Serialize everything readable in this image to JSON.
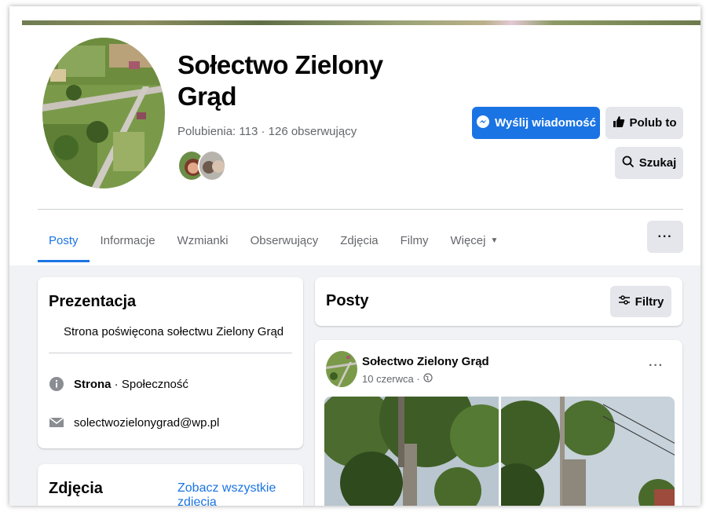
{
  "page": {
    "title": "Sołectwo Zielony Grąd",
    "stats": "Polubienia: 113 · 126 obserwujący"
  },
  "actions": {
    "message_label": "Wyślij wiadomość",
    "like_label": "Polub to",
    "search_label": "Szukaj",
    "more_label": "···"
  },
  "tabs": [
    {
      "label": "Posty",
      "active": true
    },
    {
      "label": "Informacje"
    },
    {
      "label": "Wzmianki"
    },
    {
      "label": "Obserwujący"
    },
    {
      "label": "Zdjęcia"
    },
    {
      "label": "Filmy"
    },
    {
      "label": "Więcej"
    }
  ],
  "intro": {
    "title": "Prezentacja",
    "description": "Strona poświęcona sołectwu Zielony Grąd",
    "category_bold": "Strona",
    "category_rest": " · Społeczność",
    "email": "solectwozielonygrad@wp.pl"
  },
  "photos": {
    "title": "Zdjęcia",
    "see_all": "Zobacz wszystkie zdjęcia"
  },
  "posts": {
    "title": "Posty",
    "filters_label": "Filtry",
    "items": [
      {
        "author": "Sołectwo Zielony Grąd",
        "date": "10 czerwca ·",
        "menu": "···"
      }
    ]
  },
  "colors": {
    "accent": "#1b74e4",
    "secondary_button": "#e4e6eb",
    "muted_text": "#65676b",
    "background": "#f0f2f5"
  },
  "icons": {
    "message": "messenger-icon",
    "like": "thumbs-up-icon",
    "search": "search-icon",
    "info": "info-icon",
    "email": "envelope-icon",
    "filters": "filters-icon",
    "privacy": "globe-icon"
  }
}
